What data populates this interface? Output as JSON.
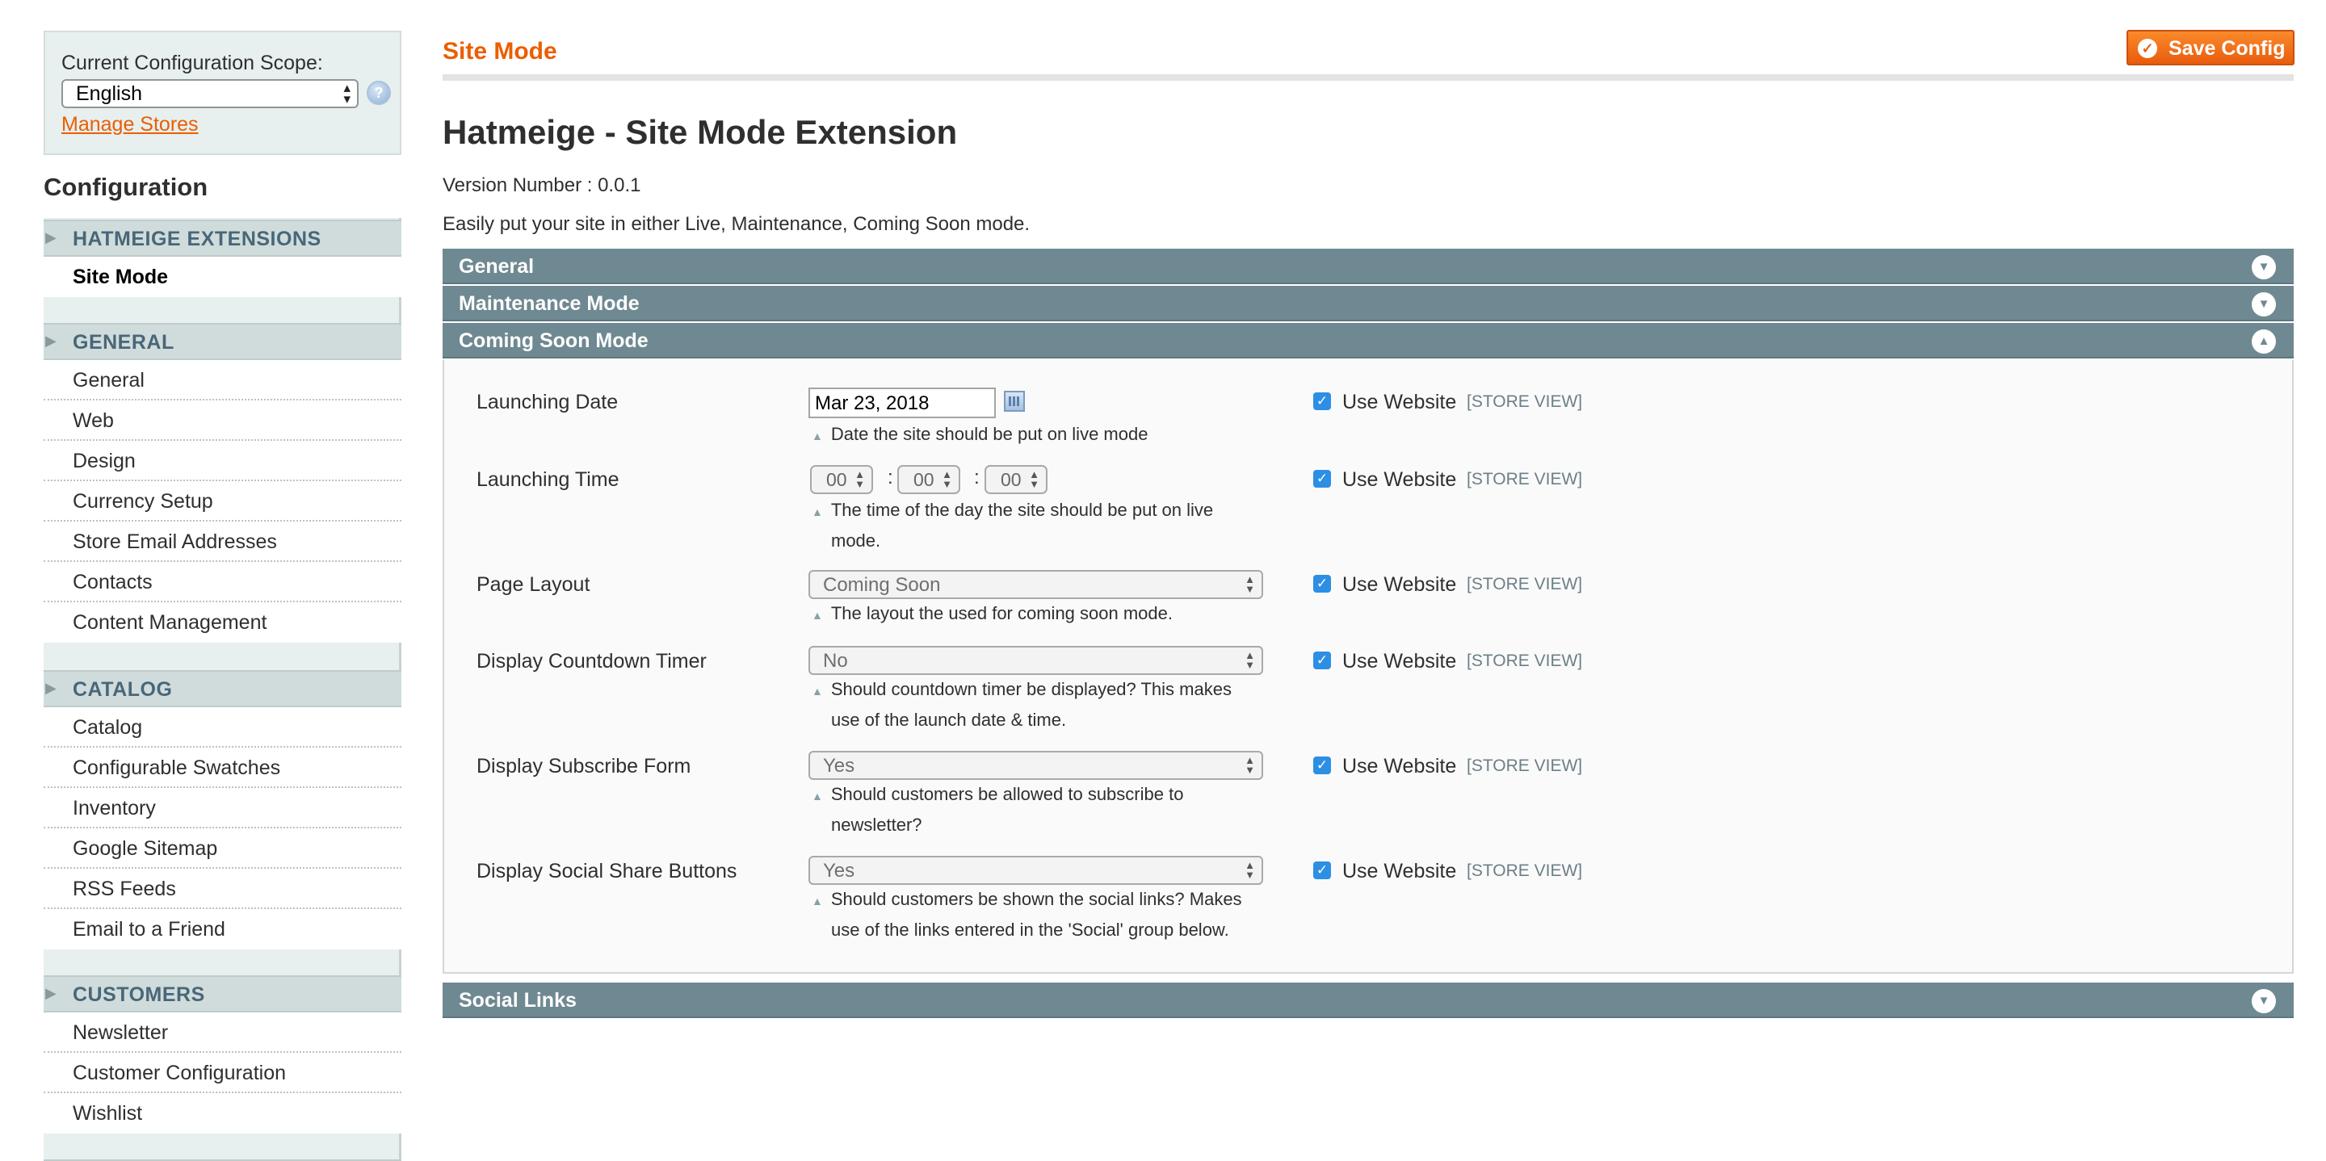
{
  "scope": {
    "label": "Current Configuration Scope:",
    "selected": "English",
    "manage_stores": "Manage Stores"
  },
  "sidebar": {
    "title": "Configuration",
    "groups": [
      {
        "label": "HATMEIGE EXTENSIONS",
        "items": [
          "Site Mode"
        ]
      },
      {
        "label": "GENERAL",
        "items": [
          "General",
          "Web",
          "Design",
          "Currency Setup",
          "Store Email Addresses",
          "Contacts",
          "Content Management"
        ]
      },
      {
        "label": "CATALOG",
        "items": [
          "Catalog",
          "Configurable Swatches",
          "Inventory",
          "Google Sitemap",
          "RSS Feeds",
          "Email to a Friend"
        ]
      },
      {
        "label": "CUSTOMERS",
        "items": [
          "Newsletter",
          "Customer Configuration",
          "Wishlist"
        ]
      }
    ]
  },
  "header": {
    "page_title": "Site Mode",
    "save_label": "Save Config"
  },
  "main": {
    "title": "Hatmeige - Site Mode Extension",
    "version": "Version Number : 0.0.1",
    "description": "Easily put your site in either Live, Maintenance, Coming Soon mode.",
    "sections": [
      "General",
      "Maintenance Mode",
      "Coming Soon Mode",
      "Social Links"
    ]
  },
  "fields": {
    "launch_date": {
      "label": "Launching Date",
      "value": "Mar 23, 2018",
      "note": "Date the site should be put on live mode"
    },
    "launch_time": {
      "label": "Launching Time",
      "hour": "00",
      "minute": "00",
      "second": "00",
      "note_1": "The time of the day the site should be put on live",
      "note_2": "mode."
    },
    "page_layout": {
      "label": "Page Layout",
      "value": "Coming Soon",
      "note": "The layout the used for coming soon mode."
    },
    "countdown": {
      "label": "Display Countdown Timer",
      "value": "No",
      "note_1": "Should countdown timer be displayed? This makes",
      "note_2": "use of the launch date & time."
    },
    "subscribe": {
      "label": "Display Subscribe Form",
      "value": "Yes",
      "note_1": "Should customers be allowed to subscribe to",
      "note_2": "newsletter?"
    },
    "social_share": {
      "label": "Display Social Share Buttons",
      "value": "Yes",
      "note_1": "Should customers be shown the social links? Makes",
      "note_2": "use of the links entered in the 'Social' group below."
    }
  },
  "common": {
    "use_website": "Use Website",
    "store_view": "[STORE VIEW]"
  }
}
